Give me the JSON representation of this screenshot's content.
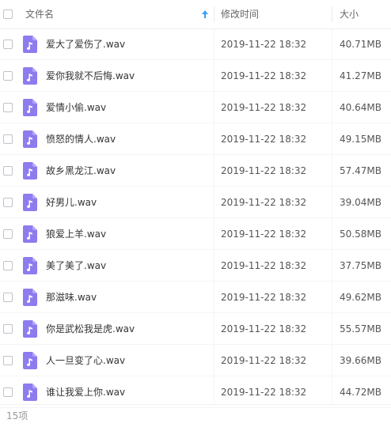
{
  "header": {
    "name_label": "文件名",
    "modified_label": "修改时间",
    "size_label": "大小",
    "sort_icon": "arrow-up-icon"
  },
  "files": [
    {
      "name": "爱大了爱伤了.wav",
      "modified": "2019-11-22 18:32",
      "size": "40.71MB"
    },
    {
      "name": "爱你我就不后悔.wav",
      "modified": "2019-11-22 18:32",
      "size": "41.27MB"
    },
    {
      "name": "爱情小偷.wav",
      "modified": "2019-11-22 18:32",
      "size": "40.64MB"
    },
    {
      "name": "愤怒的情人.wav",
      "modified": "2019-11-22 18:32",
      "size": "49.15MB"
    },
    {
      "name": "故乡黑龙江.wav",
      "modified": "2019-11-22 18:32",
      "size": "57.47MB"
    },
    {
      "name": "好男儿.wav",
      "modified": "2019-11-22 18:32",
      "size": "39.04MB"
    },
    {
      "name": "狼爱上羊.wav",
      "modified": "2019-11-22 18:32",
      "size": "50.58MB"
    },
    {
      "name": "美了美了.wav",
      "modified": "2019-11-22 18:32",
      "size": "37.75MB"
    },
    {
      "name": "那滋味.wav",
      "modified": "2019-11-22 18:32",
      "size": "49.62MB"
    },
    {
      "name": "你是武松我是虎.wav",
      "modified": "2019-11-22 18:32",
      "size": "55.57MB"
    },
    {
      "name": "人一旦变了心.wav",
      "modified": "2019-11-22 18:32",
      "size": "39.66MB"
    },
    {
      "name": "谁让我爱上你.wav",
      "modified": "2019-11-22 18:32",
      "size": "44.72MB"
    }
  ],
  "file_icon": "music-file-icon",
  "footer": {
    "count_text": "15项"
  },
  "colors": {
    "file_icon": "#8c7cf0",
    "sort_arrow": "#3aa0f3",
    "header_text": "#666666"
  }
}
